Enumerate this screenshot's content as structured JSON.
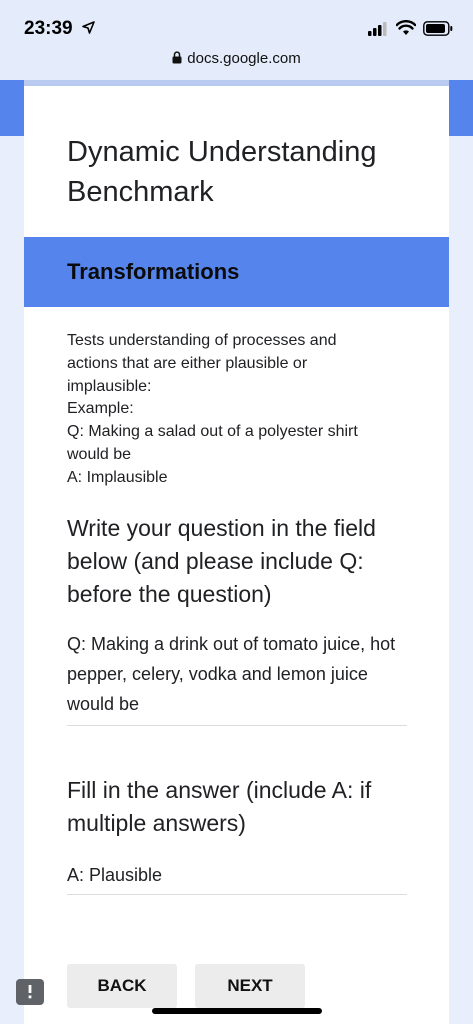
{
  "status_bar": {
    "time": "23:39",
    "url": "docs.google.com",
    "icons": [
      "location-arrow-icon",
      "signal-icon",
      "wifi-icon",
      "battery-icon",
      "lock-icon"
    ]
  },
  "form": {
    "title": "Dynamic Understanding Benchmark",
    "section_title": "Transformations",
    "section_description_lines": [
      "Tests understanding of processes and",
      "actions that are either plausible or",
      "implausible:",
      "Example:",
      "Q: Making a salad out of a polyester shirt",
      "would be",
      "A: Implausible"
    ],
    "question1": {
      "title": "Write your question in the field below (and please include Q: before the question)",
      "answer": "Q: Making a drink out of tomato juice, hot pepper, celery, vodka and lemon juice would be"
    },
    "question2": {
      "title": "Fill in the answer (include A: if multiple answers)",
      "answer": "A: Plausible"
    },
    "back_label": "BACK",
    "next_label": "NEXT"
  },
  "colors": {
    "accent": "#5585ec",
    "background": "#e8eefb",
    "button": "#ececec"
  }
}
